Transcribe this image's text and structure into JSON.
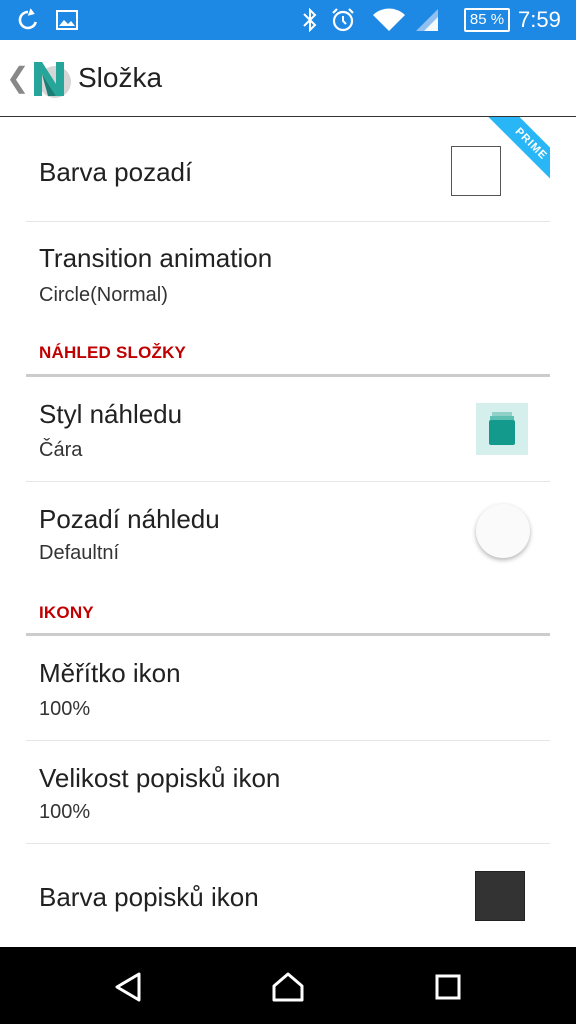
{
  "status_bar": {
    "battery": "85 %",
    "time": "7:59",
    "icons": [
      "sync-icon",
      "image-icon",
      "bluetooth-icon",
      "alarm-icon",
      "wifi-icon",
      "signal-icon",
      "battery-icon"
    ]
  },
  "header": {
    "title": "Složka",
    "logo_letter": "N"
  },
  "prime_badge": "PRIME",
  "settings": {
    "background_color": {
      "title": "Barva pozadí",
      "swatch_color": "#ffffff"
    },
    "transition": {
      "title": "Transition animation",
      "value": "Circle(Normal)"
    },
    "preview_section": "NÁHLED SLOŽKY",
    "preview_style": {
      "title": "Styl náhledu",
      "value": "Čára"
    },
    "preview_background": {
      "title": "Pozadí náhledu",
      "value": "Defaultní"
    },
    "icons_section": "IKONY",
    "icon_scale": {
      "title": "Měřítko ikon",
      "value": "100%"
    },
    "label_size": {
      "title": "Velikost popisků ikon",
      "value": "100%"
    },
    "label_color": {
      "title": "Barva popisků ikon",
      "swatch_color": "#333333"
    }
  },
  "colors": {
    "status_bar": "#1e88e5",
    "section_header": "#c00000",
    "prime_ribbon": "#29b6f6",
    "logo_teal": "#26a69a"
  },
  "nav_bar": {
    "icons": [
      "back-triangle-icon",
      "home-icon",
      "recents-icon"
    ]
  }
}
